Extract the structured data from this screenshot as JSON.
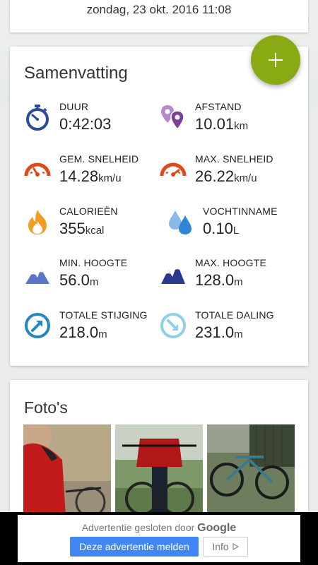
{
  "header": {
    "date": "zondag, 23 okt. 2016 11:08"
  },
  "fab": {
    "icon": "plus-icon",
    "color": "#8aaa14"
  },
  "summary": {
    "title": "Samenvatting",
    "stats": {
      "duration": {
        "label": "DUUR",
        "value": "0:42:03",
        "unit": "",
        "icon": "stopwatch-icon"
      },
      "distance": {
        "label": "AFSTAND",
        "value": "10.01",
        "unit": "km",
        "icon": "location-pins-icon"
      },
      "avg_speed": {
        "label": "GEM. SNELHEID",
        "value": "14.28",
        "unit": "km/u",
        "icon": "speedometer-icon"
      },
      "max_speed": {
        "label": "MAX. SNELHEID",
        "value": "26.22",
        "unit": "km/u",
        "icon": "speedometer-icon"
      },
      "calories": {
        "label": "CALORIEËN",
        "value": "355",
        "unit": "kcal",
        "icon": "flame-icon"
      },
      "hydration": {
        "label": "VOCHTINNAME",
        "value": "0.10",
        "unit": "L",
        "icon": "water-drops-icon"
      },
      "min_altitude": {
        "label": "MIN. HOOGTE",
        "value": "56.0",
        "unit": "m",
        "icon": "mountain-icon"
      },
      "max_altitude": {
        "label": "MAX. HOOGTE",
        "value": "128.0",
        "unit": "m",
        "icon": "mountain-icon"
      },
      "total_ascent": {
        "label": "TOTALE STIJGING",
        "value": "218.0",
        "unit": "m",
        "icon": "ascent-arrow-icon"
      },
      "total_descent": {
        "label": "TOTALE DALING",
        "value": "231.0",
        "unit": "m",
        "icon": "descent-arrow-icon"
      }
    }
  },
  "photos": {
    "title": "Foto's"
  },
  "ad": {
    "closed_text": "Advertentie gesloten door",
    "brand": "Google",
    "report_label": "Deze advertentie melden",
    "info_label": "Info",
    "report_color": "#4285f4"
  }
}
